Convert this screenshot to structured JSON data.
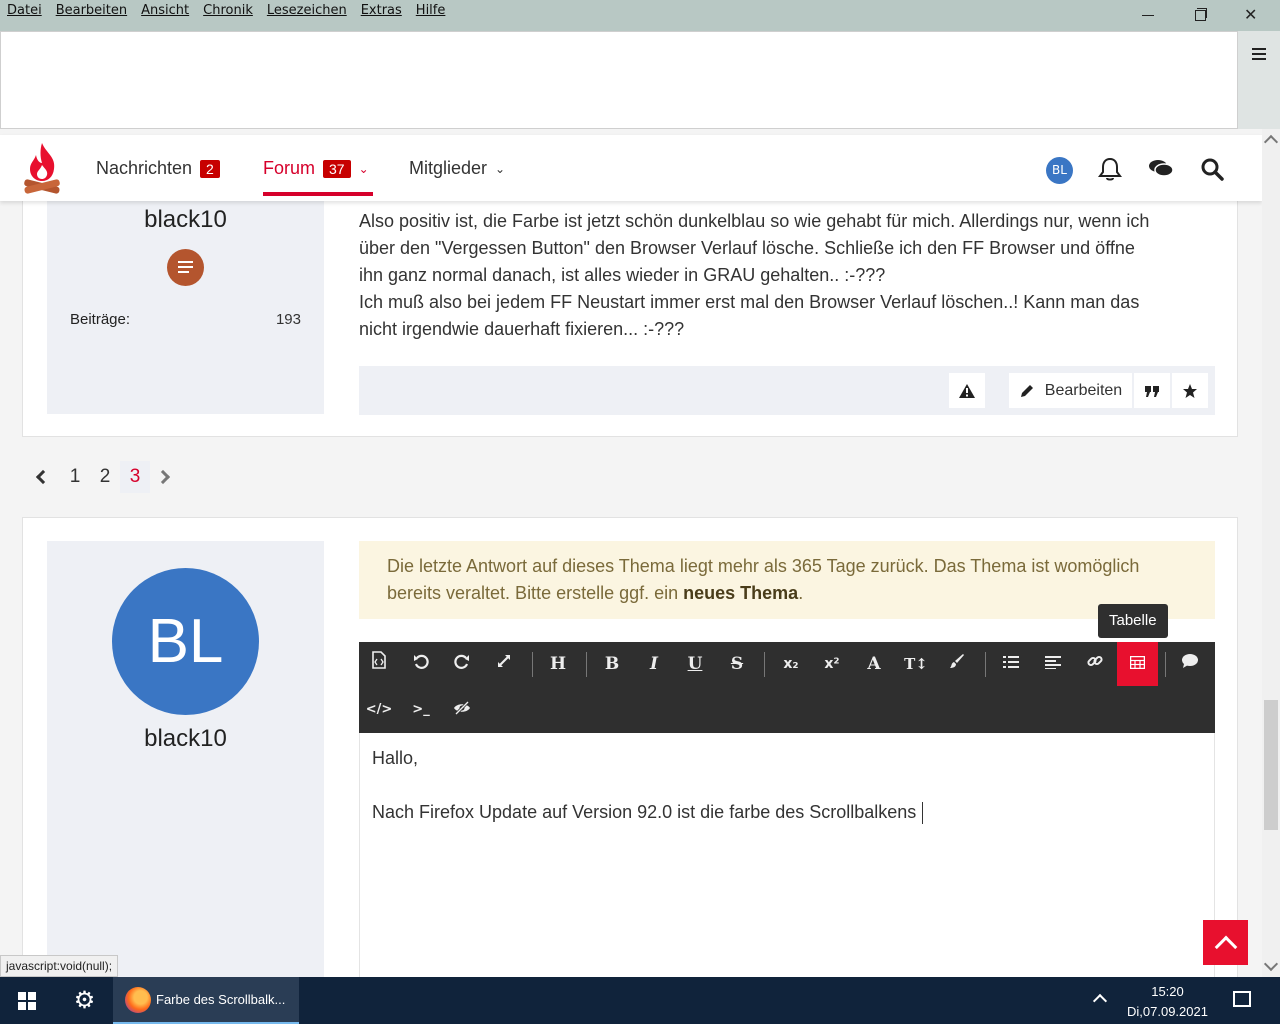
{
  "menubar": {
    "items": [
      "Datei",
      "Bearbeiten",
      "Ansicht",
      "Chronik",
      "Lesezeichen",
      "Extras",
      "Hilfe"
    ],
    "close_glyph": "✕"
  },
  "header": {
    "nav": [
      {
        "label": "Nachrichten",
        "badge": "2"
      },
      {
        "label": "Forum",
        "badge": "37"
      },
      {
        "label": "Mitglieder"
      }
    ],
    "avatar_initials": "BL",
    "chevron": "⌄"
  },
  "post1": {
    "author": "black10",
    "stat_label": "Beiträge:",
    "stat_value": "193",
    "text_lines": [
      "Also positiv ist, die Farbe ist jetzt schön dunkelblau so wie gehabt für mich. Allerdings nur, wenn ich",
      "über den \"Vergessen Button\" den Browser Verlauf lösche. Schließe ich den FF Browser und öffne",
      "ihn ganz normal danach, ist alles wieder in GRAU gehalten.. :-???",
      "Ich muß also bei jedem FF Neustart immer erst mal den Browser Verlauf löschen..! Kann man das",
      "nicht irgendwie dauerhaft fixieren... :-???"
    ],
    "edit_label": "Bearbeiten"
  },
  "pagination": {
    "pages": [
      "1",
      "2",
      "3"
    ],
    "active": "3"
  },
  "reply": {
    "avatar_initials": "BL",
    "author": "black10",
    "notice_line1": "Die letzte Antwort auf dieses Thema liegt mehr als 365 Tage zurück. Das Thema ist womöglich",
    "notice_line2_pre": "bereits veraltet. Bitte erstelle ggf. ein ",
    "notice_link": "neues Thema",
    "notice_line2_post": ".",
    "tooltip": "Tabelle",
    "editor_line1": "Hallo,",
    "editor_line2": "Nach Firefox Update auf Version 92.0 ist die farbe des Scrollbalkens"
  },
  "toolbar_glyphs": {
    "heading": "H",
    "bold": "B",
    "italic": "I",
    "underline": "U",
    "strike": "S",
    "sub": "x₂",
    "sup": "x²",
    "font": "A",
    "size": "T↕",
    "code": "</>",
    "terminal": ">_"
  },
  "status_tip": "javascript:void(null);",
  "taskbar": {
    "settings_glyph": "⚙",
    "ff_task_label": "Farbe des Scrollbalk...",
    "time": "15:20",
    "date": "Di,07.09.2021"
  },
  "colors": {
    "accent": "#d6002b",
    "avatar": "#3a76c4",
    "editor_bg": "#2f2f2f",
    "rank": "#b4552e"
  }
}
